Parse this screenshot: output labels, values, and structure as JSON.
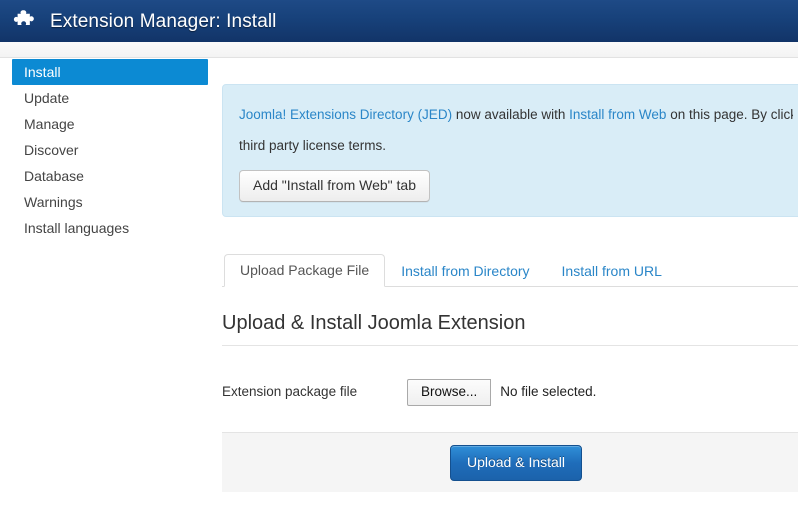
{
  "header": {
    "title": "Extension Manager: Install",
    "icon": "puzzle-piece-icon",
    "background_color": "#17417a"
  },
  "sidebar": {
    "items": [
      {
        "label": "Install",
        "active": true
      },
      {
        "label": "Update",
        "active": false
      },
      {
        "label": "Manage",
        "active": false
      },
      {
        "label": "Discover",
        "active": false
      },
      {
        "label": "Database",
        "active": false
      },
      {
        "label": "Warnings",
        "active": false
      },
      {
        "label": "Install languages",
        "active": false
      }
    ],
    "active_color": "#0c8ad3"
  },
  "banner": {
    "link_jed": "Joomla! Extensions Directory (JED)",
    "text_mid": " now available with ",
    "link_web": "Install from Web",
    "text_tail": " on this page.  By clicking",
    "line2": "third party license terms.",
    "button_label": "Add \"Install from Web\" tab",
    "background_color": "#d9edf7",
    "link_color": "#2a86c8"
  },
  "tabs": [
    {
      "label": "Upload Package File",
      "active": true
    },
    {
      "label": "Install from Directory",
      "active": false
    },
    {
      "label": "Install from URL",
      "active": false
    }
  ],
  "panel": {
    "heading": "Upload & Install Joomla Extension",
    "field_label": "Extension package file",
    "browse_label": "Browse...",
    "file_status": "No file selected.",
    "submit_label": "Upload & Install",
    "submit_color": "#1f6dba"
  }
}
